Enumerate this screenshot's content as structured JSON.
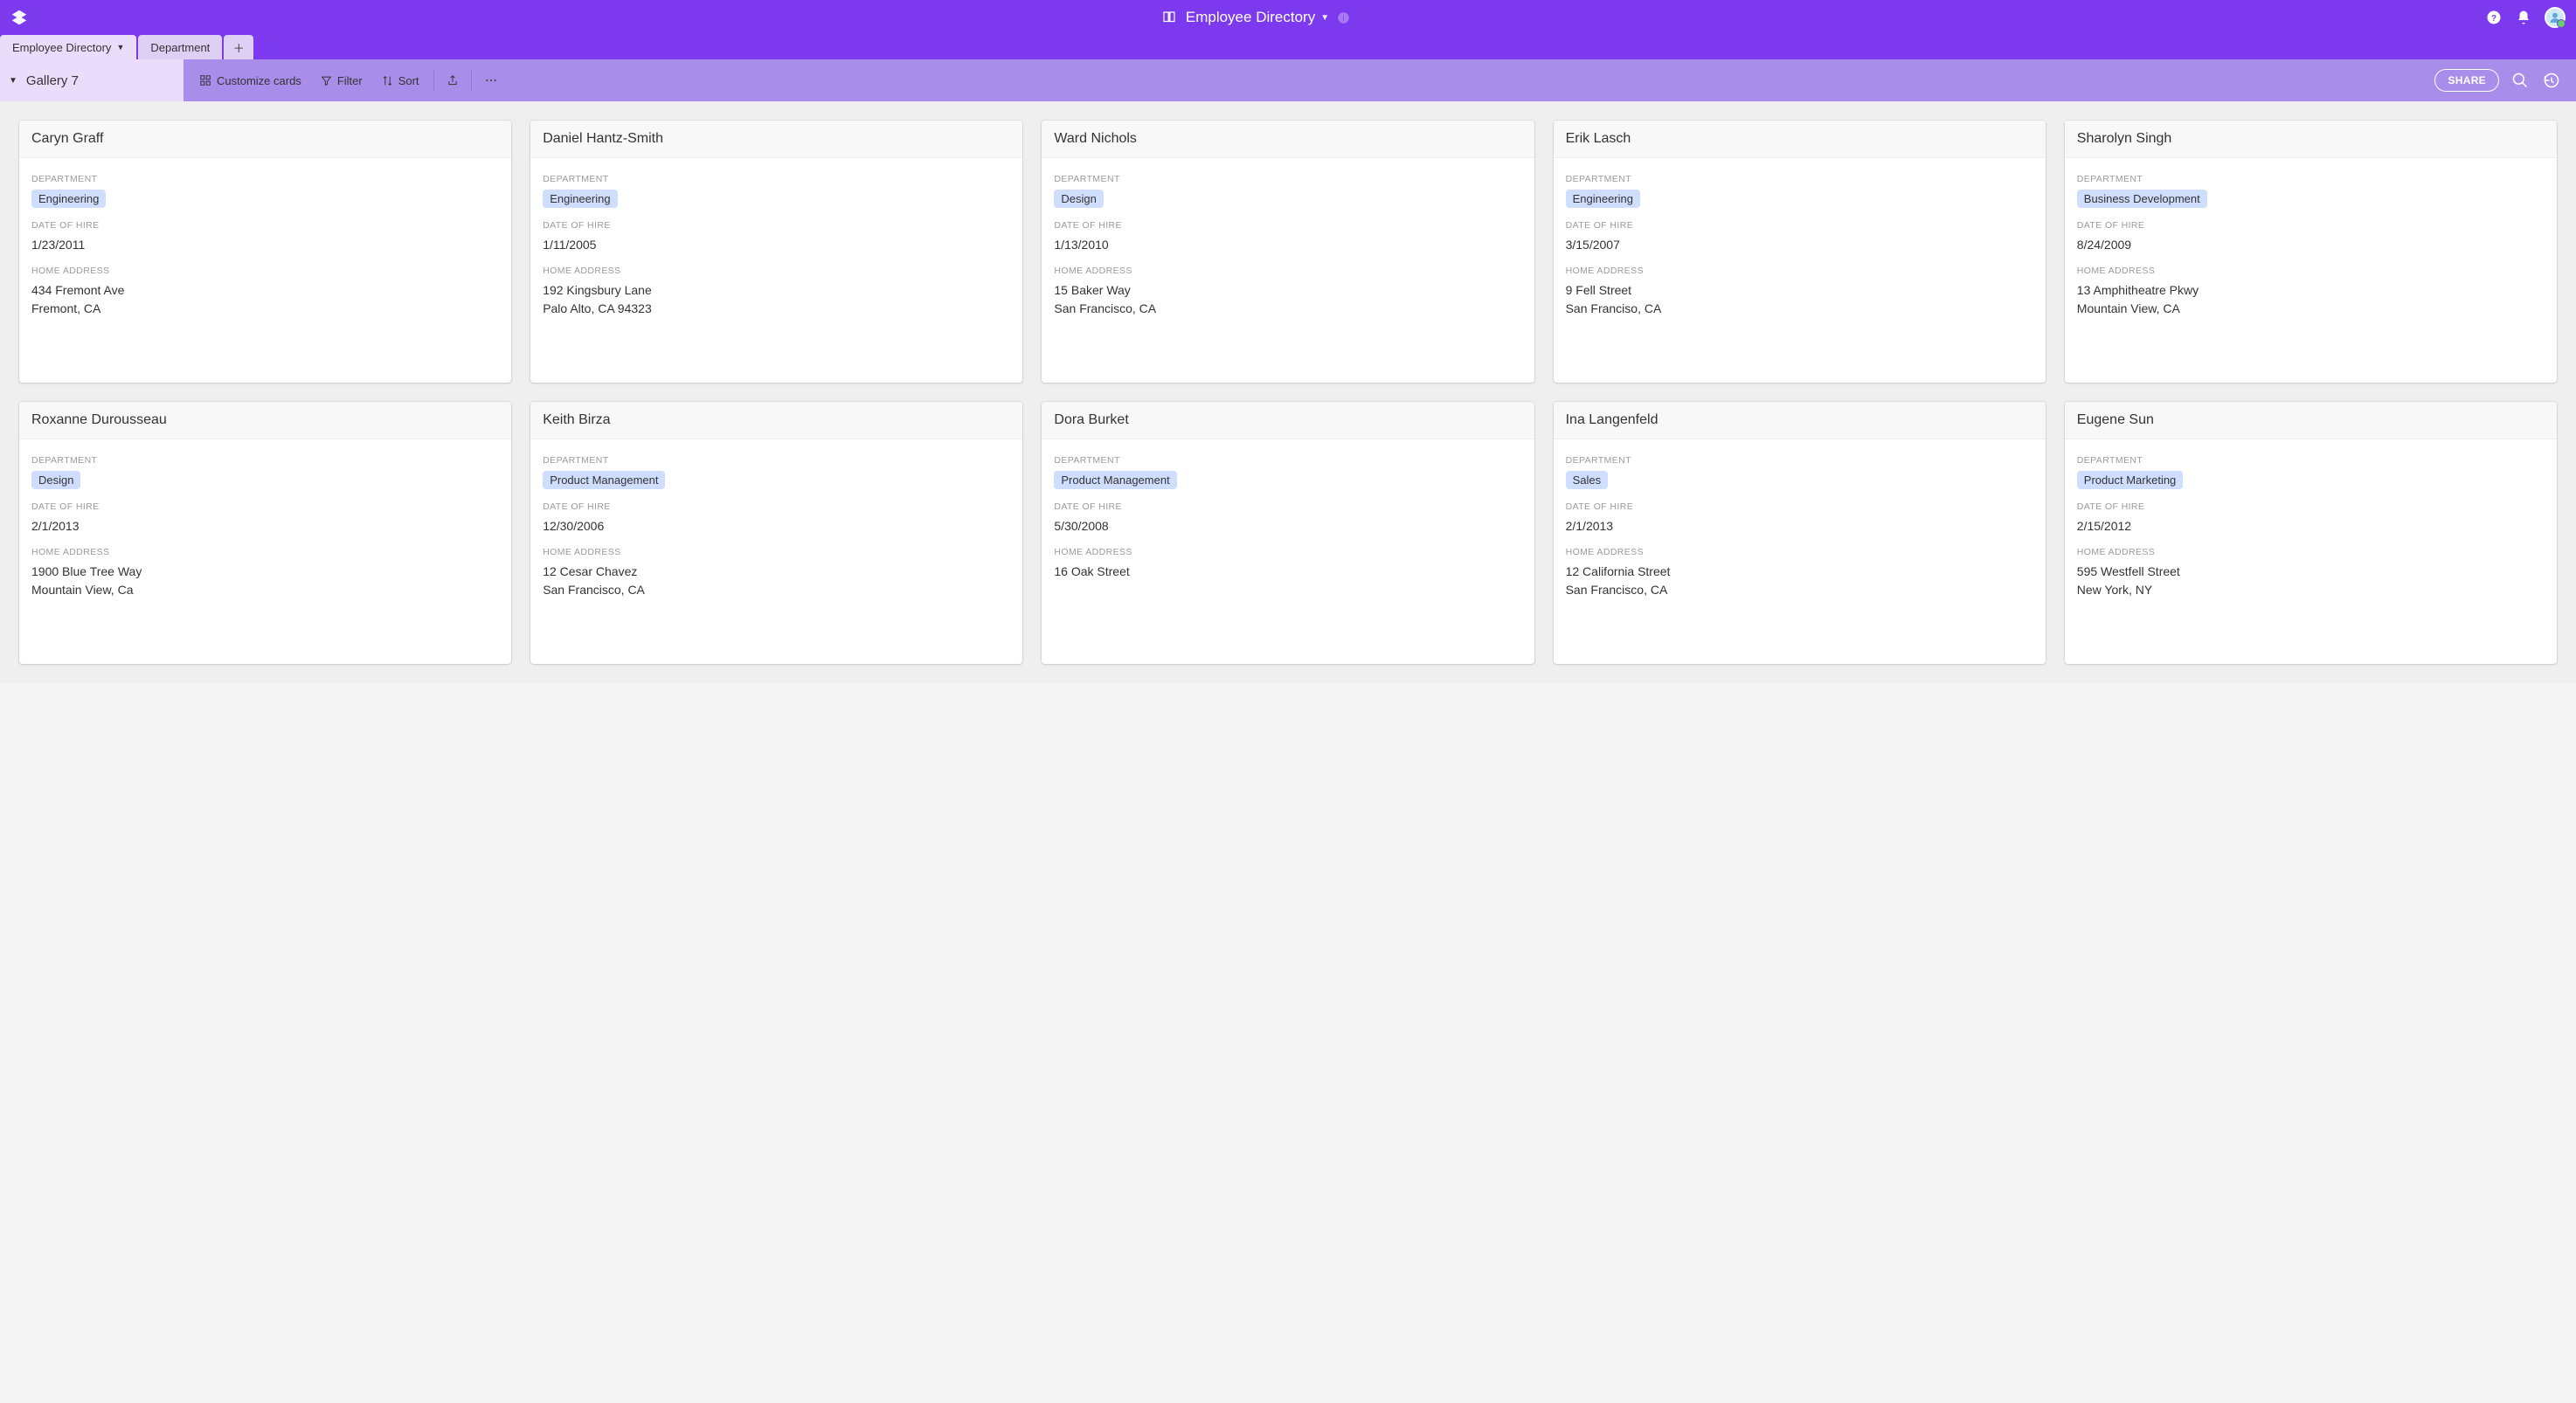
{
  "colors": {
    "primary": "#7c39ed",
    "secondary": "#a98deb",
    "tab_active": "#e9ddfb",
    "tab_secondary": "#ddd0f4",
    "chip_bg": "#cfdefe"
  },
  "header": {
    "title": "Employee Directory"
  },
  "tabs": [
    {
      "label": "Employee Directory",
      "active": true
    },
    {
      "label": "Department",
      "active": false
    }
  ],
  "view": {
    "name": "Gallery 7"
  },
  "toolbar": {
    "customize_label": "Customize cards",
    "filter_label": "Filter",
    "sort_label": "Sort",
    "share_label": "SHARE"
  },
  "field_labels": {
    "department": "DEPARTMENT",
    "date_of_hire": "DATE OF HIRE",
    "home_address": "HOME ADDRESS"
  },
  "cards": [
    {
      "name": "Caryn Graff",
      "department": "Engineering",
      "date_of_hire": "1/23/2011",
      "home_address": "434 Fremont Ave\nFremont, CA"
    },
    {
      "name": "Daniel Hantz-Smith",
      "department": "Engineering",
      "date_of_hire": "1/11/2005",
      "home_address": "192 Kingsbury Lane\nPalo Alto, CA 94323"
    },
    {
      "name": "Ward Nichols",
      "department": "Design",
      "date_of_hire": "1/13/2010",
      "home_address": "15 Baker Way\nSan Francisco, CA"
    },
    {
      "name": "Erik Lasch",
      "department": "Engineering",
      "date_of_hire": "3/15/2007",
      "home_address": "9 Fell Street\nSan Franciso, CA"
    },
    {
      "name": "Sharolyn Singh",
      "department": "Business Development",
      "date_of_hire": "8/24/2009",
      "home_address": "13 Amphitheatre Pkwy\nMountain View, CA"
    },
    {
      "name": "Roxanne Durousseau",
      "department": "Design",
      "date_of_hire": "2/1/2013",
      "home_address": "1900 Blue Tree Way\nMountain View, Ca"
    },
    {
      "name": "Keith Birza",
      "department": "Product Management",
      "date_of_hire": "12/30/2006",
      "home_address": "12 Cesar Chavez\nSan Francisco, CA"
    },
    {
      "name": "Dora Burket",
      "department": "Product Management",
      "date_of_hire": "5/30/2008",
      "home_address": "16 Oak Street"
    },
    {
      "name": "Ina Langenfeld",
      "department": "Sales",
      "date_of_hire": "2/1/2013",
      "home_address": "12 California Street\nSan Francisco, CA"
    },
    {
      "name": "Eugene Sun",
      "department": "Product Marketing",
      "date_of_hire": "2/15/2012",
      "home_address": "595 Westfell Street\nNew York, NY"
    }
  ]
}
